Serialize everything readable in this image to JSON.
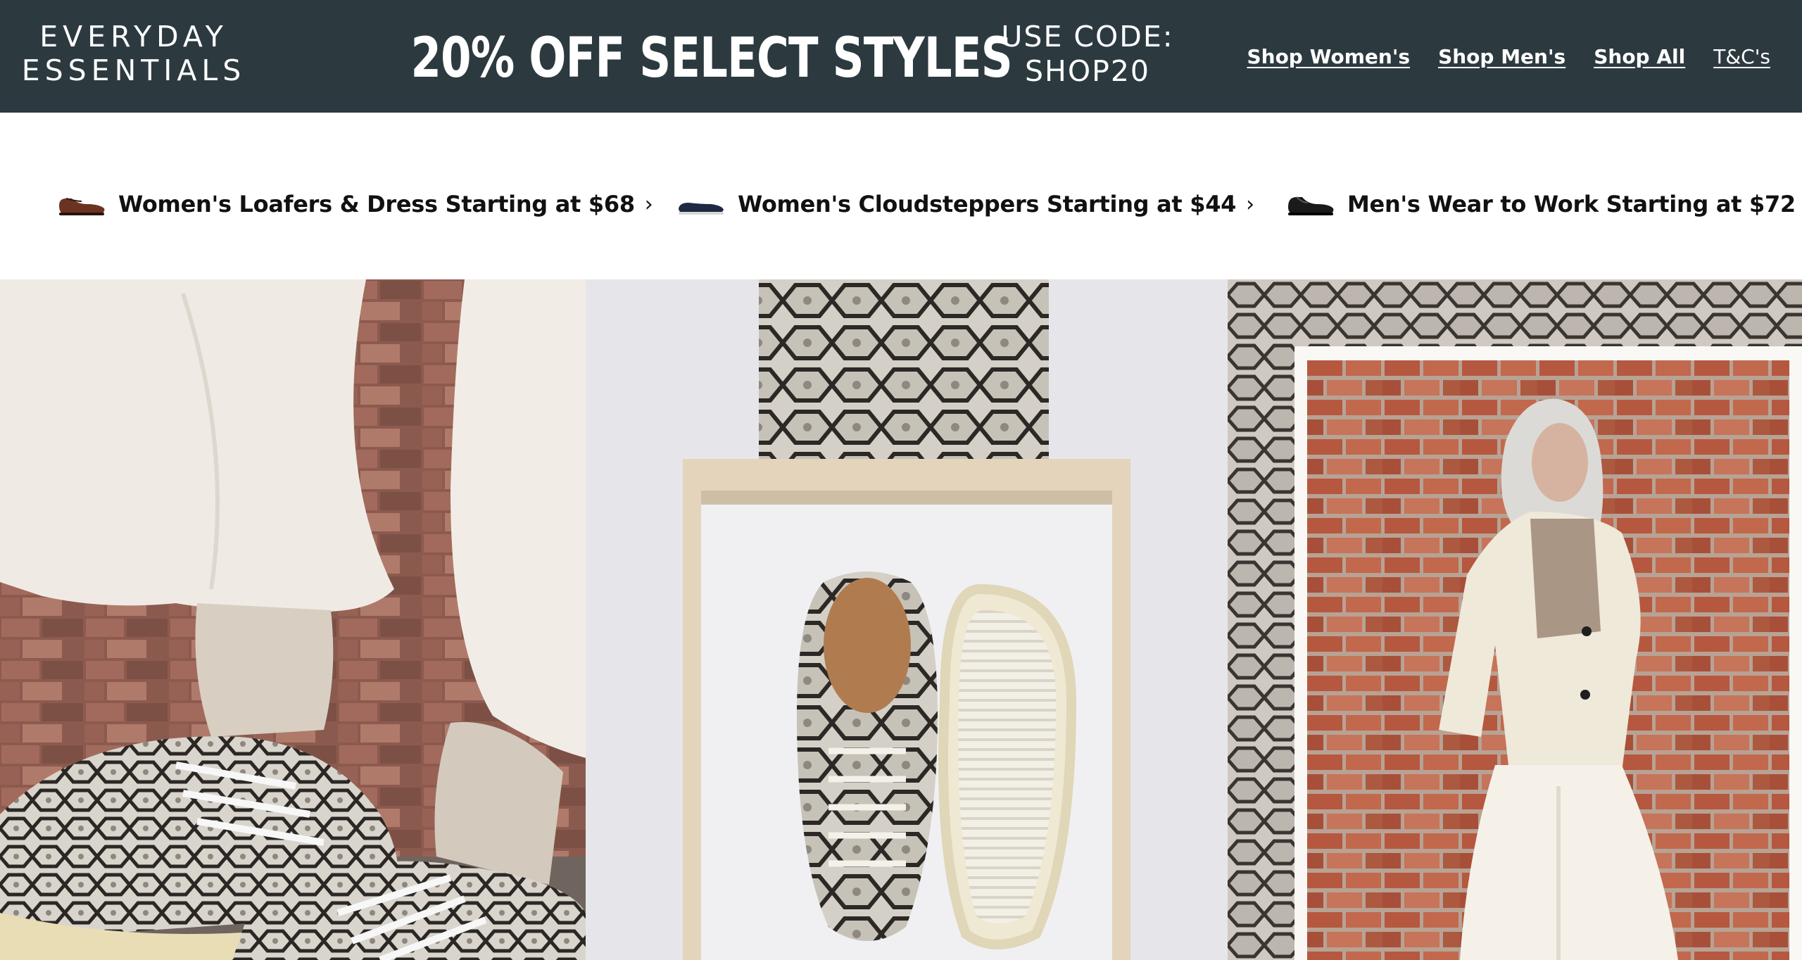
{
  "banner": {
    "brand_line1": "EVERYDAY",
    "brand_line2": "ESSENTIALS",
    "headline": "20% OFF SELECT STYLES",
    "code_line1": "USE CODE:",
    "code_line2": "SHOP20",
    "nav": [
      {
        "label": "Shop Women's"
      },
      {
        "label": "Shop Men's"
      },
      {
        "label": "Shop All"
      },
      {
        "label": "T&C's"
      }
    ],
    "background_color": "#2c3a40"
  },
  "categories": [
    {
      "label": "Women's Loafers & Dress Starting at $68",
      "icon": "brown-loafer-icon"
    },
    {
      "label": "Women's Cloudsteppers Starting at $44",
      "icon": "navy-flat-icon"
    },
    {
      "label": "Men's Wear to Work Starting at $72",
      "icon": "black-dress-shoe-icon"
    }
  ],
  "hero": {
    "panels": [
      {
        "name": "snakeskin-sneakers-on-feet-photo"
      },
      {
        "name": "snakeskin-sneaker-in-frame-photo"
      },
      {
        "name": "woman-against-brick-wall-photo"
      }
    ]
  }
}
